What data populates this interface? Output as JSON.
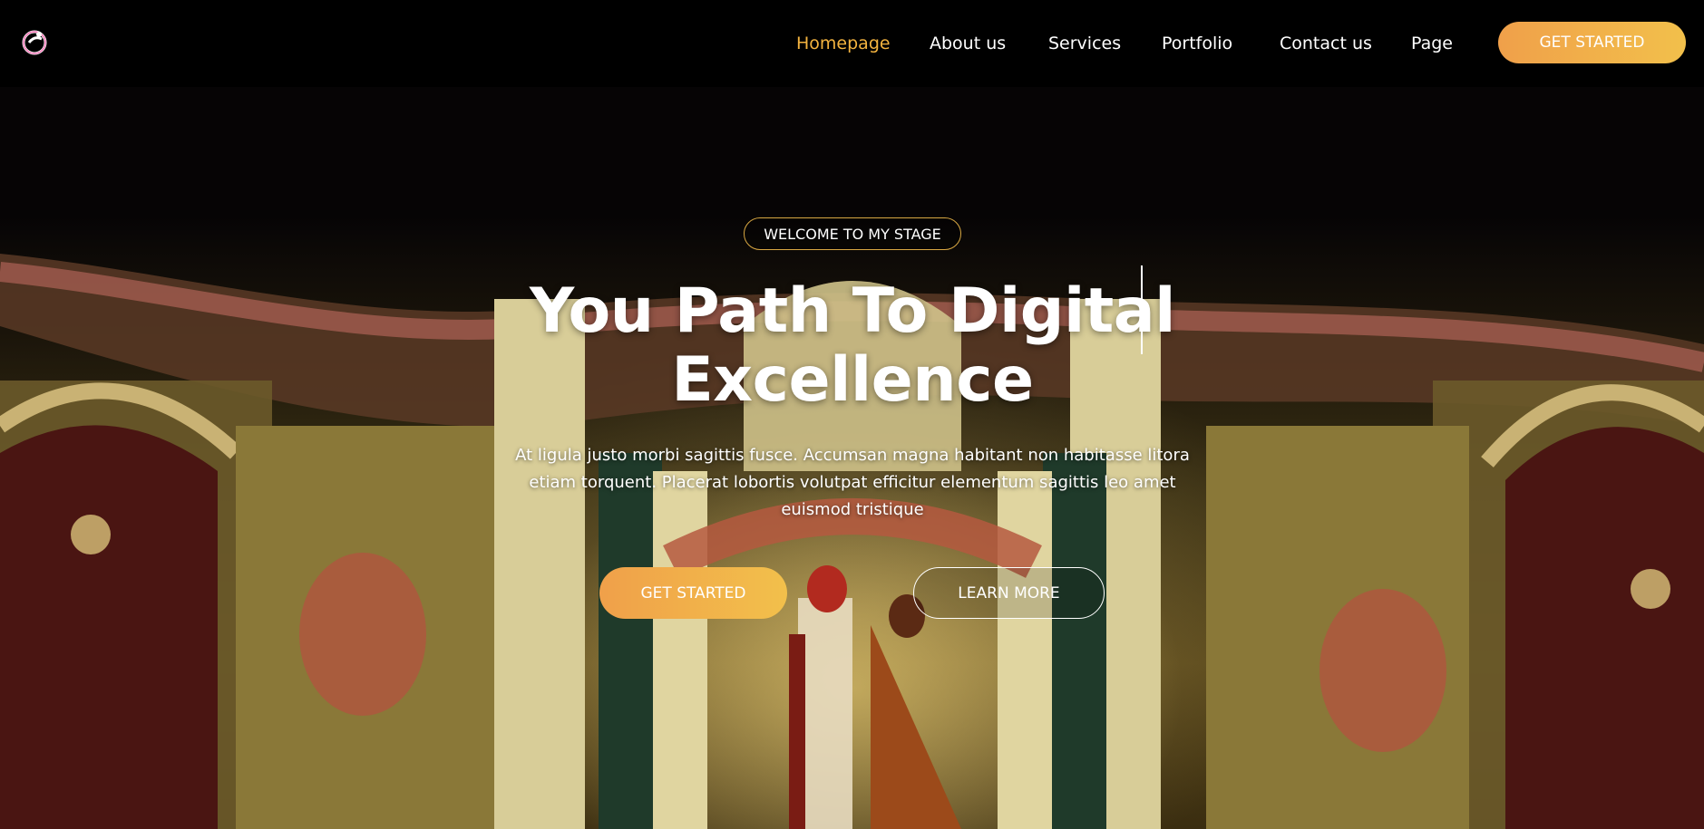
{
  "header": {
    "logo_icon": "ring-logo-icon",
    "nav": [
      {
        "label": "Homepage",
        "active": true
      },
      {
        "label": "About us",
        "active": false
      },
      {
        "label": "Services",
        "active": false
      },
      {
        "label": "Portfolio",
        "active": false
      },
      {
        "label": "Contact us",
        "active": false
      },
      {
        "label": "Page",
        "active": false
      }
    ],
    "cta_label": "GET STARTED"
  },
  "hero": {
    "badge": "WELCOME TO MY STAGE",
    "title_line1": "You Path To Digital",
    "title_line2": "Excellence",
    "subtitle": "At ligula justo morbi sagittis fusce. Accumsan magna habitant non habitasse litora etiam torquent. Placerat lobortis volutpat efficitur elementum sagittis leo amet euismod tristique",
    "primary_button": "GET STARTED",
    "secondary_button": "LEARN MORE",
    "background_image": "wedding-stage-photo"
  },
  "colors": {
    "accent": "#f3b33f",
    "button_gradient_start": "#f0a04a",
    "button_gradient_end": "#f2c04b",
    "badge_border": "#d8a742",
    "background": "#050304"
  }
}
